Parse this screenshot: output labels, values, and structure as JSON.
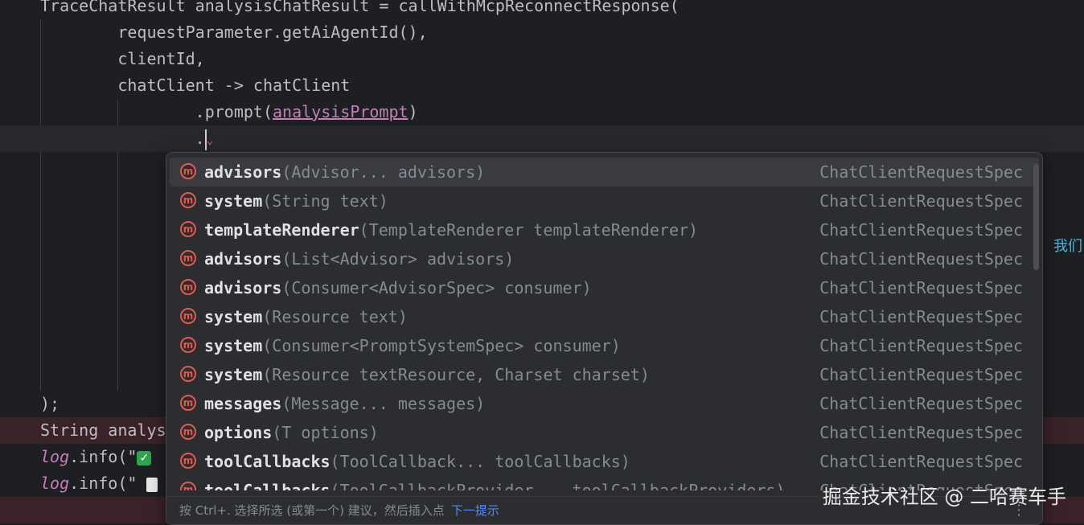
{
  "code_lines": [
    "TraceChatResult analysisChatResult = callWithMcpReconnectResponse(",
    "        requestParameter.getAiAgentId(),",
    "        clientId,",
    "        chatClient -> chatClient",
    "                .prompt(",
    "analysisPrompt",
    ")",
    "                .",
    ");",
    "String analys",
    "log",
    ".info(\"",
    "log",
    ".info(\""
  ],
  "side_text": "我们",
  "completion": {
    "items": [
      {
        "name": "advisors",
        "params": "(Advisor... advisors)",
        "type": "ChatClientRequestSpec",
        "selected": true
      },
      {
        "name": "system",
        "params": "(String text)",
        "type": "ChatClientRequestSpec"
      },
      {
        "name": "templateRenderer",
        "params": "(TemplateRenderer templateRenderer)",
        "type": "ChatClientRequestSpec"
      },
      {
        "name": "advisors",
        "params": "(List<Advisor> advisors)",
        "type": "ChatClientRequestSpec"
      },
      {
        "name": "advisors",
        "params": "(Consumer<AdvisorSpec> consumer)",
        "type": "ChatClientRequestSpec"
      },
      {
        "name": "system",
        "params": "(Resource text)",
        "type": "ChatClientRequestSpec"
      },
      {
        "name": "system",
        "params": "(Consumer<PromptSystemSpec> consumer)",
        "type": "ChatClientRequestSpec"
      },
      {
        "name": "system",
        "params": "(Resource textResource, Charset charset)",
        "type": "ChatClientRequestSpec"
      },
      {
        "name": "messages",
        "params": "(Message... messages)",
        "type": "ChatClientRequestSpec"
      },
      {
        "name": "options",
        "params": "(T options)",
        "type": "ChatClientRequestSpec"
      },
      {
        "name": "toolCallbacks",
        "params": "(ToolCallback... toolCallbacks)",
        "type": "ChatClientRequestSpec"
      },
      {
        "name": "toolCallbacks",
        "params": "(ToolCallbackProvider... toolCallbackProviders)",
        "type": "ChatClientRequestSpec"
      }
    ],
    "icon_letter": "m",
    "footer_hint": "按 Ctrl+. 选择所选 (或第一个) 建议，然后插入点",
    "footer_link": "下一提示",
    "footer_more": "⋮"
  },
  "watermark": "掘金技术社区 @ 二哈赛车手",
  "colors": {
    "accent_link": "#548af7",
    "method_icon": "#e05a4f",
    "error_line": "#3a2228"
  }
}
